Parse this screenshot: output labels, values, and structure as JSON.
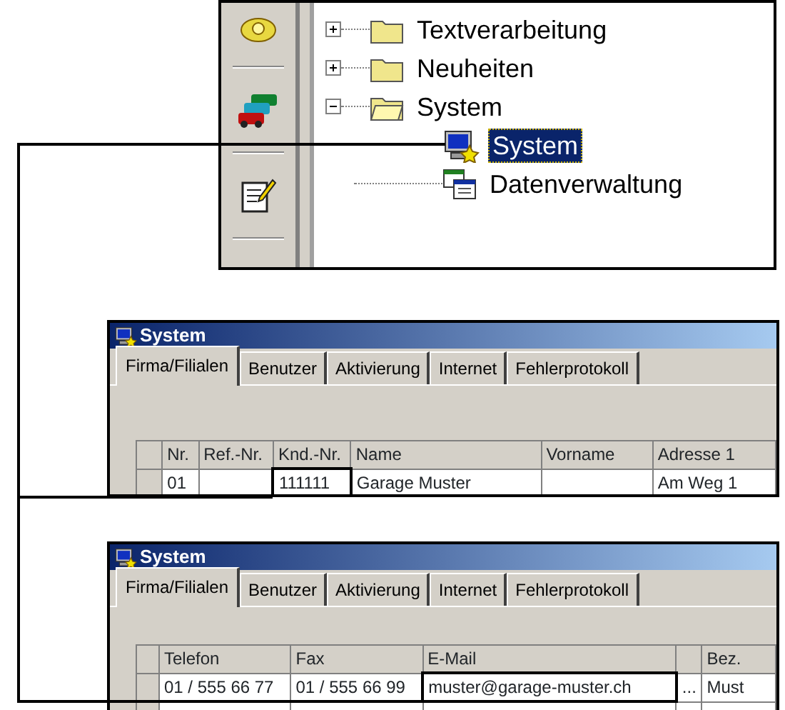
{
  "tree": [
    {
      "label": "Textverarbeitung",
      "kind": "folder",
      "expanded": false,
      "selected": false
    },
    {
      "label": "Neuheiten",
      "kind": "folder",
      "expanded": false,
      "selected": false
    },
    {
      "label": "System",
      "kind": "folder",
      "expanded": true,
      "selected": false,
      "children": [
        {
          "label": "System",
          "kind": "system",
          "selected": true
        },
        {
          "label": "Datenverwaltung",
          "kind": "data",
          "selected": false
        }
      ]
    }
  ],
  "windows": [
    {
      "title": "System",
      "tabs": [
        {
          "label": "Firma/Filialen",
          "selected": true
        },
        {
          "label": "Benutzer",
          "selected": false
        },
        {
          "label": "Aktivierung",
          "selected": false
        },
        {
          "label": "Internet",
          "selected": false
        },
        {
          "label": "Fehlerprotokoll",
          "selected": false
        }
      ],
      "table": {
        "columns": [
          {
            "kind": "text",
            "label": "Nr."
          },
          {
            "kind": "text",
            "label": "Ref.-Nr."
          },
          {
            "kind": "text",
            "label": "Knd.-Nr."
          },
          {
            "kind": "text",
            "label": "Name"
          },
          {
            "kind": "text",
            "label": "Vorname"
          },
          {
            "kind": "text",
            "label": "Adresse 1"
          }
        ],
        "rows": [
          {
            "cells": [
              {
                "text": "01",
                "highlighted": false
              },
              {
                "highlighted": false
              },
              {
                "text": "111111",
                "highlighted": true
              },
              {
                "text": "Garage Muster",
                "highlighted": false
              },
              {
                "highlighted": false
              },
              {
                "text": "Am Weg 1",
                "highlighted": false
              }
            ]
          }
        ]
      }
    },
    {
      "title": "System",
      "tabs": [
        {
          "label": "Firma/Filialen",
          "selected": true
        },
        {
          "label": "Benutzer",
          "selected": false
        },
        {
          "label": "Aktivierung",
          "selected": false
        },
        {
          "label": "Internet",
          "selected": false
        },
        {
          "label": "Fehlerprotokoll",
          "selected": false
        }
      ],
      "table": {
        "columns": [
          {
            "kind": "text",
            "label": "Telefon"
          },
          {
            "kind": "text",
            "label": "Fax"
          },
          {
            "kind": "text",
            "label": "E-Mail"
          },
          {
            "kind": "blank"
          },
          {
            "kind": "text",
            "label": "Bez."
          }
        ],
        "rows": [
          {
            "cells": [
              {
                "text": "01 / 555 66 77",
                "highlighted": false
              },
              {
                "text": "01 / 555 66 99",
                "highlighted": false
              },
              {
                "text": "muster@garage-muster.ch",
                "highlighted": true
              },
              {
                "text": "...",
                "highlighted": false
              },
              {
                "text": "Must",
                "highlighted": false
              }
            ]
          }
        ]
      }
    }
  ]
}
